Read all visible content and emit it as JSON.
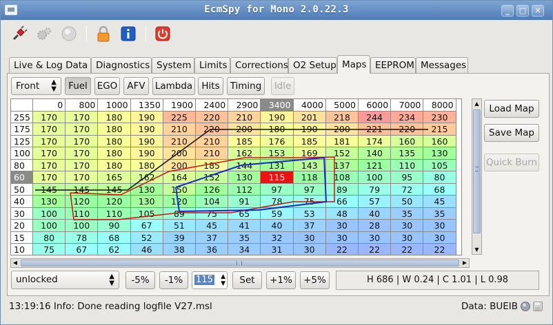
{
  "window": {
    "title": "EcmSpy for Mono 2.0.22.3"
  },
  "tabs": [
    "Live & Log Data",
    "Diagnostics",
    "System",
    "Limits",
    "Corrections",
    "O2 Setup",
    "Maps",
    "EEPROM",
    "Messages"
  ],
  "active_tab": "Maps",
  "map_controls": {
    "cylinder_select": "Front",
    "buttons": [
      "Fuel",
      "EGO",
      "AFV",
      "Lambda",
      "Hits",
      "Timing",
      "Idle"
    ],
    "pressed": "Fuel",
    "disabled": "Idle"
  },
  "side_buttons": {
    "load_map": "Load Map",
    "save_map": "Save Map",
    "quick_burn": "Quick Burn"
  },
  "table": {
    "corner": "",
    "columns": [
      "0",
      "800",
      "1000",
      "1350",
      "1900",
      "2400",
      "2900",
      "3400",
      "4000",
      "5000",
      "6000",
      "7000",
      "8000"
    ],
    "highlight_column": "3400",
    "highlight_row": "60",
    "rows": [
      {
        "label": "255",
        "values": [
          "170",
          "170",
          "180",
          "190",
          "225",
          "220",
          "210",
          "190",
          "201",
          "218",
          "244",
          "234",
          "230"
        ]
      },
      {
        "label": "175",
        "values": [
          "170",
          "170",
          "180",
          "190",
          "210",
          "220",
          "200",
          "180",
          "190",
          "200",
          "221",
          "220",
          "215"
        ]
      },
      {
        "label": "125",
        "values": [
          "170",
          "170",
          "180",
          "190",
          "210",
          "210",
          "185",
          "176",
          "185",
          "181",
          "174",
          "160",
          "160"
        ]
      },
      {
        "label": "100",
        "values": [
          "170",
          "170",
          "180",
          "190",
          "200",
          "210",
          "162",
          "153",
          "169",
          "152",
          "140",
          "135",
          "130"
        ]
      },
      {
        "label": "80",
        "values": [
          "170",
          "170",
          "180",
          "180",
          "200",
          "185",
          "144",
          "131",
          "143",
          "137",
          "121",
          "110",
          "105"
        ]
      },
      {
        "label": "60",
        "values": [
          "170",
          "170",
          "165",
          "162",
          "164",
          "152",
          "130",
          "115",
          "118",
          "108",
          "100",
          "95",
          "80"
        ]
      },
      {
        "label": "50",
        "values": [
          "145",
          "145",
          "145",
          "130",
          "150",
          "126",
          "112",
          "97",
          "97",
          "89",
          "79",
          "72",
          "68"
        ]
      },
      {
        "label": "40",
        "values": [
          "130",
          "120",
          "120",
          "130",
          "120",
          "104",
          "91",
          "78",
          "75",
          "66",
          "57",
          "50",
          "45"
        ]
      },
      {
        "label": "30",
        "values": [
          "100",
          "110",
          "110",
          "105",
          "89",
          "75",
          "65",
          "59",
          "53",
          "48",
          "40",
          "35",
          "35"
        ]
      },
      {
        "label": "20",
        "values": [
          "100",
          "100",
          "90",
          "67",
          "51",
          "45",
          "41",
          "40",
          "37",
          "30",
          "28",
          "30",
          "30"
        ]
      },
      {
        "label": "15",
        "values": [
          "80",
          "78",
          "68",
          "52",
          "39",
          "37",
          "35",
          "32",
          "30",
          "30",
          "30",
          "30",
          "30"
        ]
      },
      {
        "label": "10",
        "values": [
          "75",
          "67",
          "62",
          "46",
          "38",
          "36",
          "34",
          "31",
          "30",
          "22",
          "22",
          "22",
          "22"
        ]
      }
    ],
    "selected_value": "115"
  },
  "bottom_controls": {
    "lock_select": "unlocked",
    "minus5": "-5%",
    "minus1": "-1%",
    "value": "115",
    "set": "Set",
    "plus1": "+1%",
    "plus5": "+5%",
    "info": "H 686 | W 0.24 | C 1.01 | L 0.98"
  },
  "status": {
    "message": "13:19:16 Info: Done reading logfile V27.msl",
    "data_label": "Data: BUEIB"
  },
  "colors": {
    "selected_cell": "#ee1111",
    "title_bar": "#5a86bf"
  },
  "icons": [
    "connect-plug-icon",
    "settings-gear-icon",
    "status-light-icon",
    "lock-icon",
    "info-icon",
    "power-icon"
  ]
}
